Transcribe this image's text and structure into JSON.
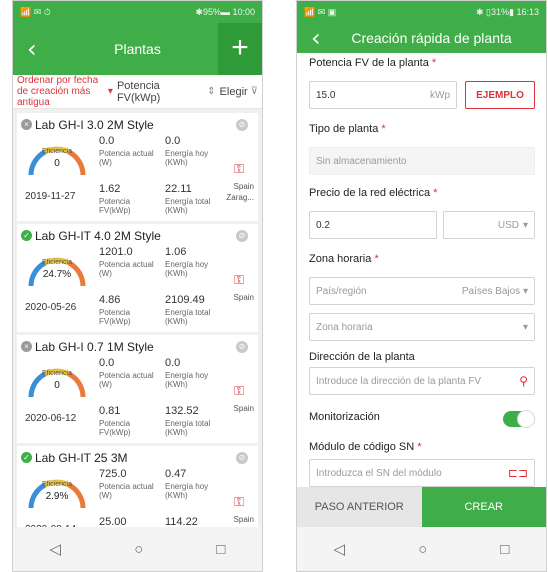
{
  "left": {
    "status": {
      "left": "📶 ✉ ⏱",
      "right": "✱95%▬ 10:00"
    },
    "header": {
      "back": "‹",
      "title": "Plantas",
      "add": "+"
    },
    "sort": {
      "order": "Ordenar por fecha de creación más antigua",
      "arrow": "▾",
      "power": "Potencia FV(kWp)",
      "sep": "⇕",
      "choose": "Elegir",
      "filter": "⊽"
    },
    "cards": [
      {
        "name": "Lab GH-I 3.0 2M Style",
        "status": "off",
        "eff_label": "Eficiencia",
        "eff": "0",
        "date": "2019-11-27",
        "cur_power": "0.0",
        "cur_power_label": "Potencia actual (W)",
        "today": "0.0",
        "today_label": "Energía hoy (KWh)",
        "pv_power": "1.62",
        "pv_power_label": "Potencia FV(kWp)",
        "total": "22.11",
        "total_label": "Energía total (KWh)",
        "country": "Spain",
        "city": "Zarag..."
      },
      {
        "name": "Lab GH-IT 4.0 2M Style",
        "status": "on",
        "eff_label": "Eficiencia",
        "eff": "24.7%",
        "date": "2020-05-26",
        "cur_power": "1201.0",
        "cur_power_label": "Potencia actual (W)",
        "today": "1.06",
        "today_label": "Energía hoy (KWh)",
        "pv_power": "4.86",
        "pv_power_label": "Potencia FV(kWp)",
        "total": "2109.49",
        "total_label": "Energía total (KWh)",
        "country": "Spain",
        "city": ""
      },
      {
        "name": "Lab GH-I 0.7 1M Style",
        "status": "off",
        "eff_label": "Eficiencia",
        "eff": "0",
        "date": "2020-06-12",
        "cur_power": "0.0",
        "cur_power_label": "Potencia actual (W)",
        "today": "0.0",
        "today_label": "Energía hoy (KWh)",
        "pv_power": "0.81",
        "pv_power_label": "Potencia FV(kWp)",
        "total": "132.52",
        "total_label": "Energía total (KWh)",
        "country": "Spain",
        "city": ""
      },
      {
        "name": "Lab GH-IT 25 3M",
        "status": "on",
        "eff_label": "Eficiencia",
        "eff": "2.9%",
        "date": "2020-08-14",
        "cur_power": "725.0",
        "cur_power_label": "Potencia actual (W)",
        "today": "0.47",
        "today_label": "Energía hoy (KWh)",
        "pv_power": "25.00",
        "pv_power_label": "Potencia",
        "total": "114.22",
        "total_label": "Energía total",
        "country": "Spain",
        "city": ""
      }
    ],
    "nav": {
      "back": "◁",
      "home": "○",
      "recent": "□"
    }
  },
  "right": {
    "status": {
      "left": "📶 ✉ ▣",
      "right": "✱ ▯31%▮ 16:13"
    },
    "header": {
      "back": "‹",
      "title": "Creación rápida de planta"
    },
    "fields": {
      "pv_label": "Potencia FV de la planta",
      "pv_value": "15.0",
      "pv_unit": "kWp",
      "example": "EJEMPLO",
      "type_label": "Tipo de planta",
      "type_value": "Sin almacenamiento",
      "price_label": "Precio de la red eléctrica",
      "price_value": "0.2",
      "currency": "USD",
      "tz_label": "Zona horaria",
      "country_ph": "País/región",
      "country_value": "Países Bajos",
      "tz_ph": "Zona horaria",
      "addr_label": "Dirección de la planta",
      "addr_ph": "Introduce la dirección de la planta FV",
      "monitor_label": "Monitorización",
      "sn_label": "Módulo de código SN",
      "sn_ph": "Introduzca el SN del módulo",
      "req": "*"
    },
    "buttons": {
      "prev": "PASO ANTERIOR",
      "create": "CREAR"
    },
    "nav": {
      "back": "◁",
      "home": "○",
      "recent": "□"
    }
  },
  "colors": {
    "accent": "#3fae48",
    "red": "#e0313b"
  }
}
